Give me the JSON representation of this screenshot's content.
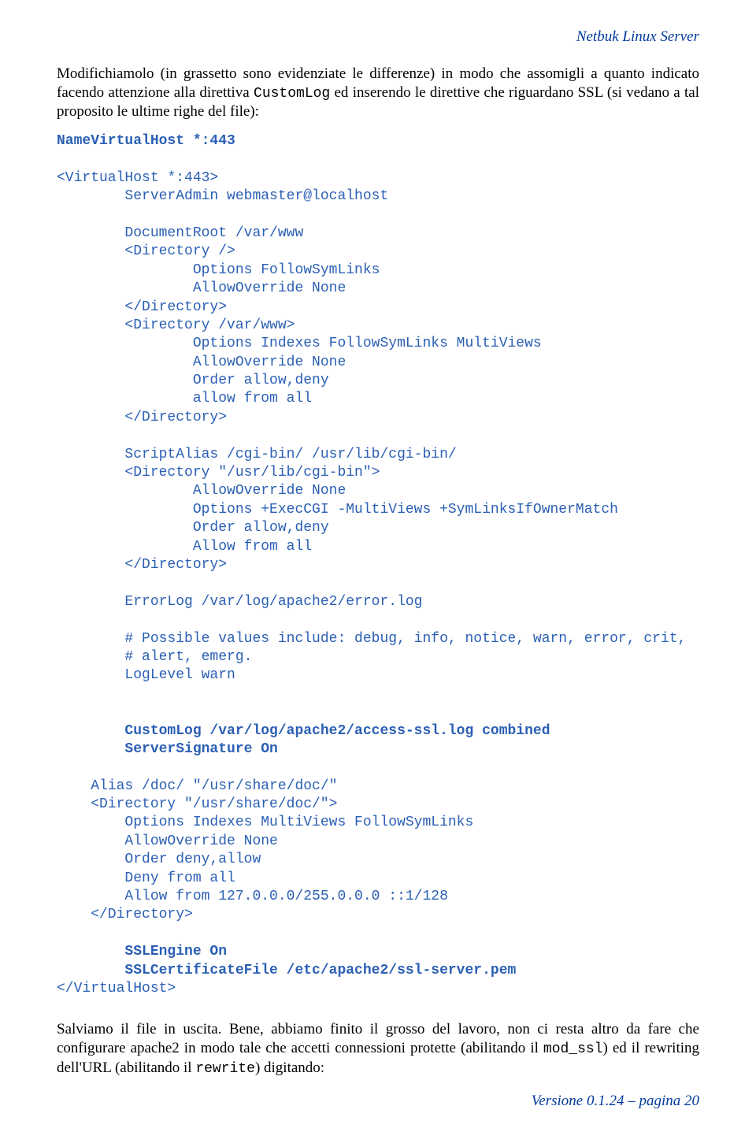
{
  "header": "Netbuk Linux Server",
  "footer": "Versione 0.1.24 – pagina 20",
  "para1_pre": "Modifichiamolo (in grassetto sono evidenziate le differenze) in modo che assomigli a quanto indicato facendo attenzione alla direttiva ",
  "para1_code": "CustomLog",
  "para1_post": " ed inserendo le direttive che riguardano SSL (si vedano a tal proposito le ultime righe del file):",
  "code": {
    "l01": "NameVirtualHost *:443",
    "l02": "",
    "l03": "<VirtualHost *:443>",
    "l04": "        ServerAdmin webmaster@localhost",
    "l05": "",
    "l06": "        DocumentRoot /var/www",
    "l07": "        <Directory />",
    "l08": "                Options FollowSymLinks",
    "l09": "                AllowOverride None",
    "l10": "        </Directory>",
    "l11": "        <Directory /var/www>",
    "l12": "                Options Indexes FollowSymLinks MultiViews",
    "l13": "                AllowOverride None",
    "l14": "                Order allow,deny",
    "l15": "                allow from all",
    "l16": "        </Directory>",
    "l17": "",
    "l18": "        ScriptAlias /cgi-bin/ /usr/lib/cgi-bin/",
    "l19": "        <Directory \"/usr/lib/cgi-bin\">",
    "l20": "                AllowOverride None",
    "l21": "                Options +ExecCGI -MultiViews +SymLinksIfOwnerMatch",
    "l22": "                Order allow,deny",
    "l23": "                Allow from all",
    "l24": "        </Directory>",
    "l25": "",
    "l26": "        ErrorLog /var/log/apache2/error.log",
    "l27": "",
    "l28": "        # Possible values include: debug, info, notice, warn, error, crit,",
    "l29": "        # alert, emerg.",
    "l30": "        LogLevel warn",
    "l31": "",
    "l32": "",
    "l33": "        CustomLog /var/log/apache2/access-ssl.log combined",
    "l34": "        ServerSignature On",
    "l35": "",
    "l36": "    Alias /doc/ \"/usr/share/doc/\"",
    "l37": "    <Directory \"/usr/share/doc/\">",
    "l38": "        Options Indexes MultiViews FollowSymLinks",
    "l39": "        AllowOverride None",
    "l40": "        Order deny,allow",
    "l41": "        Deny from all",
    "l42": "        Allow from 127.0.0.0/255.0.0.0 ::1/128",
    "l43": "    </Directory>",
    "l44": "",
    "l45": "        SSLEngine On",
    "l46": "        SSLCertificateFile /etc/apache2/ssl-server.pem",
    "l47": "</VirtualHost>"
  },
  "para2_pre": "Salviamo il file in uscita. Bene, abbiamo finito il grosso del lavoro, non ci resta altro da fare che configurare apache2 in modo tale che accetti connessioni protette  (abilitando il ",
  "para2_code1": "mod_ssl",
  "para2_mid": ") ed il rewriting dell'URL (abilitando il ",
  "para2_code2": "rewrite",
  "para2_post": ") digitando:"
}
